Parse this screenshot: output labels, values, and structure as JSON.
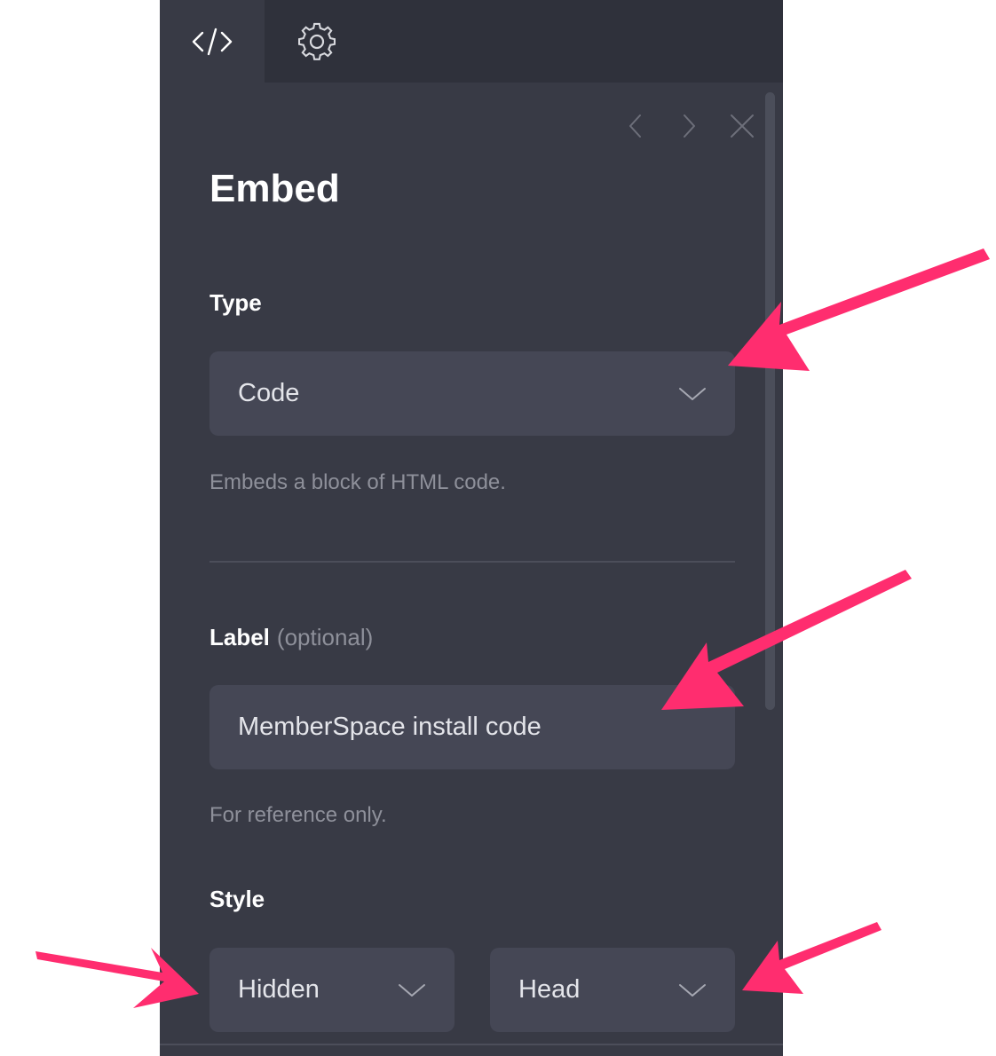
{
  "tabs": [
    {
      "icon": "code-icon",
      "active": true
    },
    {
      "icon": "gear-icon",
      "active": false
    }
  ],
  "nav": {
    "prev_icon": "chevron-left-icon",
    "next_icon": "chevron-right-icon",
    "close_icon": "close-icon"
  },
  "panel": {
    "title": "Embed",
    "type": {
      "label": "Type",
      "value": "Code",
      "help": "Embeds a block of HTML code."
    },
    "label_field": {
      "label": "Label",
      "optional": "(optional)",
      "value": "MemberSpace install code",
      "help": "For reference only."
    },
    "style": {
      "label": "Style",
      "visibility_value": "Hidden",
      "position_value": "Head"
    }
  },
  "colors": {
    "panel_bg": "#383a45",
    "tab_strip_bg": "#2f313b",
    "control_bg": "#454755",
    "annotation_arrow": "#ff2d6f"
  }
}
